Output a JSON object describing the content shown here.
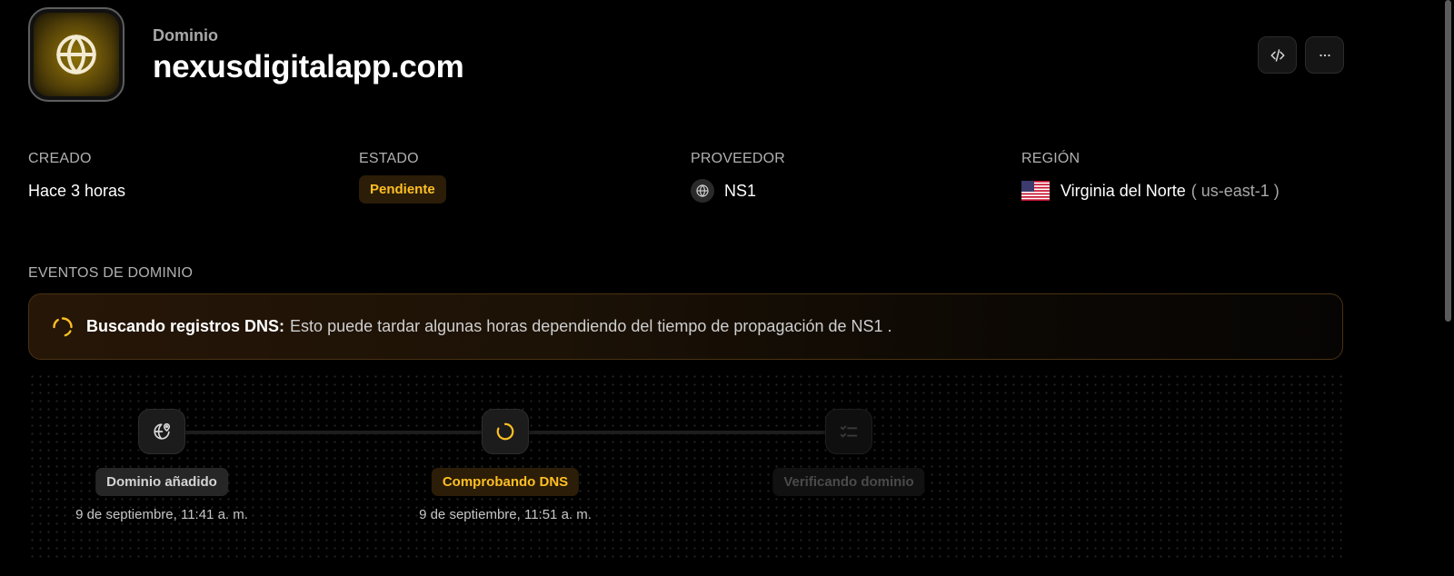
{
  "header": {
    "kicker": "Dominio",
    "title": "nexusdigitalapp.com",
    "code_button_icon": "code-icon",
    "more_button_icon": "ellipsis-icon"
  },
  "meta": {
    "created": {
      "label": "CREADO",
      "value": "Hace 3 horas"
    },
    "status": {
      "label": "ESTADO",
      "value": "Pendiente"
    },
    "provider": {
      "label": "PROVEEDOR",
      "value": "NS1",
      "icon": "globe-icon"
    },
    "region": {
      "label": "REGIÓN",
      "value": "Virginia del Norte",
      "code": "( us-east-1 )",
      "flag": "us-flag-icon"
    }
  },
  "events": {
    "title": "EVENTOS DE DOMINIO",
    "banner": {
      "title": "Buscando registros DNS:",
      "text": "Esto puede tardar algunas horas dependiendo del tiempo de propagación de NS1 ."
    },
    "steps": [
      {
        "label": "Dominio añadido",
        "date": "9 de septiembre, 11:41 a. m.",
        "state": "done",
        "icon": "globe-pin-icon"
      },
      {
        "label": "Comprobando DNS",
        "date": "9 de septiembre, 11:51 a. m.",
        "state": "active",
        "icon": "spinner-icon"
      },
      {
        "label": "Verificando dominio",
        "date": "",
        "state": "pending",
        "icon": "checklist-icon"
      }
    ]
  },
  "colors": {
    "accent": "#ffbf24",
    "background": "#000000",
    "pending_badge_bg": "#2b1d08"
  }
}
